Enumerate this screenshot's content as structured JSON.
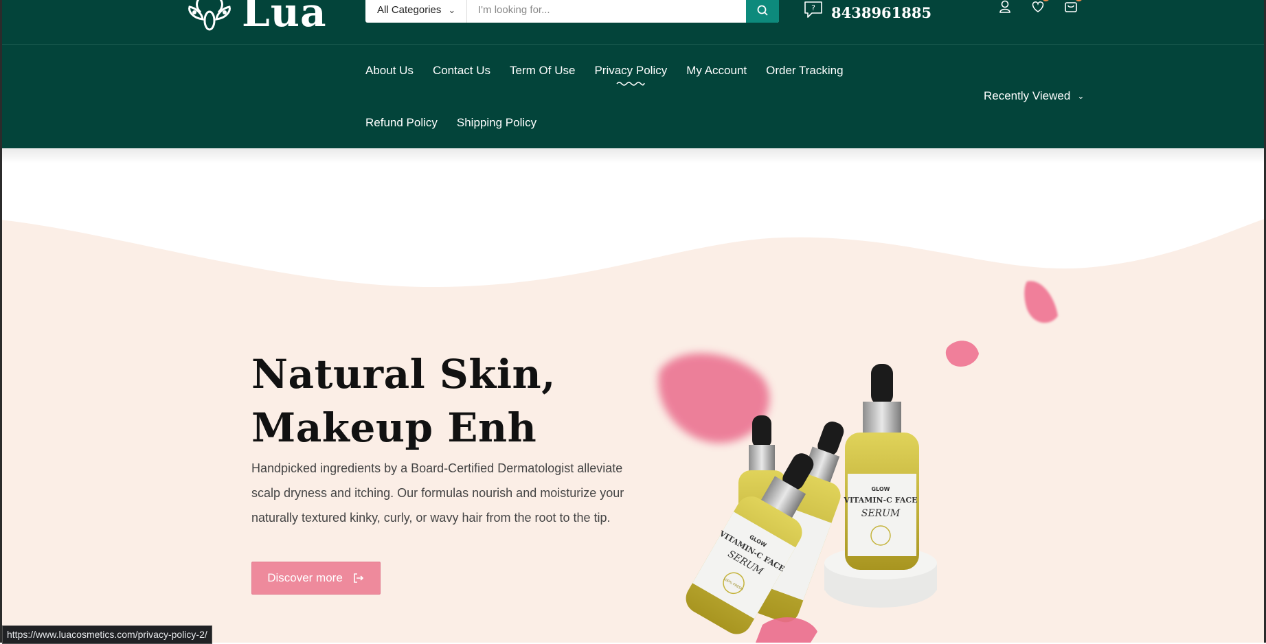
{
  "brand": {
    "name": "Lua"
  },
  "search": {
    "category_label": "All Categories",
    "placeholder": "I'm looking for..."
  },
  "contact": {
    "phone": "8438961885"
  },
  "nav": {
    "row1": [
      "About Us",
      "Contact Us",
      "Term Of Use",
      "Privacy Policy",
      "My Account",
      "Order Tracking"
    ],
    "row2": [
      "Refund Policy",
      "Shipping Policy"
    ],
    "active": "Privacy Policy",
    "recently_viewed": "Recently Viewed"
  },
  "hero": {
    "title_line1": "Natural Skin,",
    "title_line2": "Makeup Enh",
    "description": "Handpicked ingredients by a Board-Certified Dermatologist alleviate scalp dryness and itching. Our formulas nourish and moisturize your naturally textured kinky, curly, or wavy hair from the root to the tip.",
    "cta_label": "Discover more",
    "product_label_brand": "GLOW",
    "product_label_name": "VITAMIN-C FACE",
    "product_label_type": "SERUM",
    "product_badge": "100% FRESH"
  },
  "status_bar": {
    "url": "https://www.luacosmetics.com/privacy-policy-2/"
  },
  "colors": {
    "header_bg": "#03443a",
    "search_button": "#0d8a7c",
    "cta": "#ee8a9c",
    "hero_bg": "#fbeee6",
    "badge": "#f08a4b"
  },
  "icons": [
    "leaf-logo-icon",
    "chevron-down-icon",
    "search-icon",
    "chat-question-icon",
    "user-icon",
    "heart-icon",
    "cart-icon",
    "squiggle-underline-icon",
    "logout-arrow-icon"
  ]
}
